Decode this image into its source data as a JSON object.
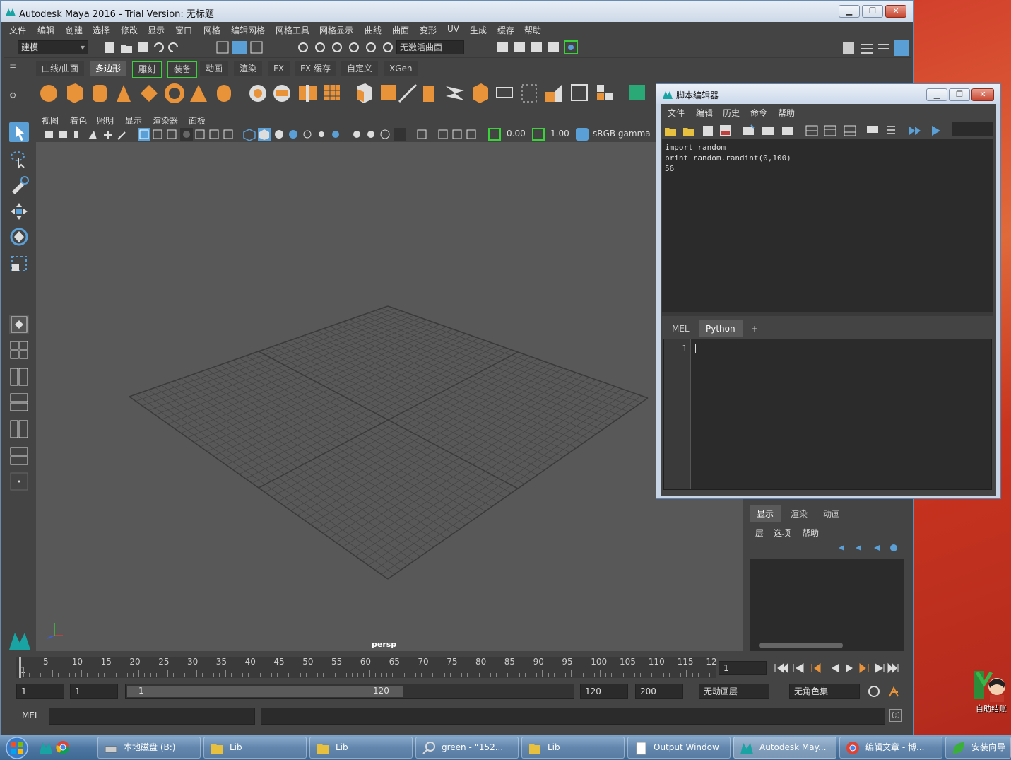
{
  "window": {
    "title": "Autodesk Maya 2016 - Trial Version: 无标题"
  },
  "menubar": [
    "文件",
    "编辑",
    "创建",
    "选择",
    "修改",
    "显示",
    "窗口",
    "网格",
    "编辑网格",
    "网格工具",
    "网格显示",
    "曲线",
    "曲面",
    "变形",
    "UV",
    "生成",
    "缓存",
    "帮助"
  ],
  "toolbar": {
    "mode": "建模",
    "no_active_surface": "无激活曲面"
  },
  "shelf_tabs": [
    "曲线/曲面",
    "多边形",
    "雕刻",
    "装备",
    "动画",
    "渲染",
    "FX",
    "FX 缓存",
    "自定义",
    "XGen"
  ],
  "panel_menu": [
    "视图",
    "着色",
    "照明",
    "显示",
    "渲染器",
    "面板"
  ],
  "panel_toolbar": {
    "value1": "0.00",
    "value2": "1.00",
    "color_space": "sRGB gamma"
  },
  "viewport": {
    "camera_label": "persp"
  },
  "timeline": {
    "ticks": [
      "1",
      "5",
      "10",
      "15",
      "20",
      "25",
      "30",
      "35",
      "40",
      "45",
      "50",
      "55",
      "60",
      "65",
      "70",
      "75",
      "80",
      "85",
      "90",
      "95",
      "100",
      "105",
      "110",
      "115",
      "12"
    ],
    "current_frame": "1"
  },
  "range": {
    "start": "1",
    "playback_start": "1",
    "slider_start": "1",
    "slider_end": "120",
    "playback_end": "120",
    "end": "200",
    "anim_layer": "无动画层",
    "char_set": "无角色集"
  },
  "command_line": {
    "mode": "MEL"
  },
  "layer_panel": {
    "tabs": [
      "显示",
      "渲染",
      "动画"
    ],
    "menu": [
      "层",
      "选项",
      "帮助"
    ]
  },
  "script_editor": {
    "title": "脚本编辑器",
    "menu": [
      "文件",
      "编辑",
      "历史",
      "命令",
      "帮助"
    ],
    "output_lines": [
      "import random",
      "print random.randint(0,100)",
      "56"
    ],
    "tabs": [
      "MEL",
      "Python",
      "+"
    ],
    "line_number": "1"
  },
  "taskbar": {
    "items": [
      "本地磁盘 (B:)",
      "Lib",
      "Lib",
      "green -  “152...",
      "Lib",
      "Output Window",
      "Autodesk May...",
      "编辑文章 - 博...",
      "安装向导"
    ]
  },
  "desktop": {
    "icon_label": "自助结账"
  },
  "colors": {
    "maya_bg": "#444444",
    "viewport": "#585858",
    "accent_orange": "#e8923a",
    "highlight_blue": "#5a9fd6"
  }
}
